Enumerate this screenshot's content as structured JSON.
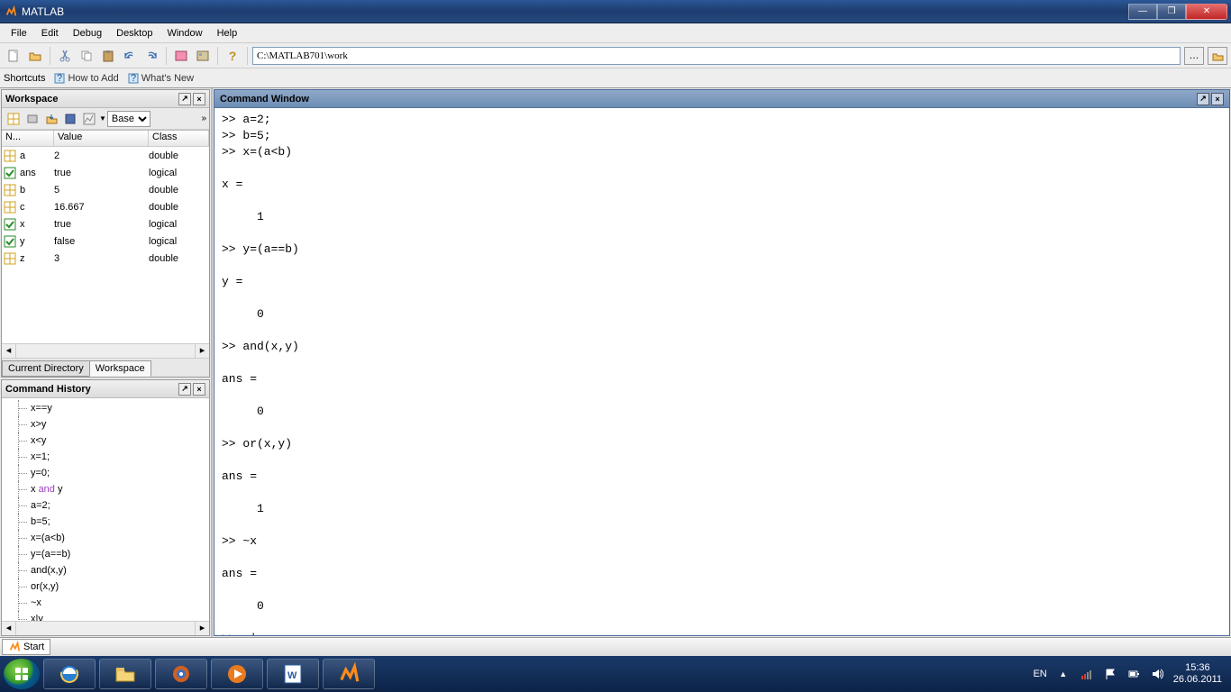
{
  "window": {
    "title": "MATLAB"
  },
  "menu": [
    "File",
    "Edit",
    "Debug",
    "Desktop",
    "Window",
    "Help"
  ],
  "toolbar": {
    "path": "C:\\MATLAB701\\work"
  },
  "shortcuts": {
    "label": "Shortcuts",
    "howto": "How to Add",
    "whatsnew": "What's New"
  },
  "workspace": {
    "title": "Workspace",
    "scope": "Base",
    "headers": {
      "name": "N...",
      "value": "Value",
      "class": "Class"
    },
    "rows": [
      {
        "icon": "grid",
        "name": "a",
        "value": "2",
        "class": "double"
      },
      {
        "icon": "bool",
        "name": "ans",
        "value": "true",
        "class": "logical"
      },
      {
        "icon": "grid",
        "name": "b",
        "value": "5",
        "class": "double"
      },
      {
        "icon": "grid",
        "name": "c",
        "value": "16.667",
        "class": "double"
      },
      {
        "icon": "bool",
        "name": "x",
        "value": "true",
        "class": "logical"
      },
      {
        "icon": "bool",
        "name": "y",
        "value": "false",
        "class": "logical"
      },
      {
        "icon": "grid",
        "name": "z",
        "value": "3",
        "class": "double"
      }
    ],
    "tabs": {
      "currentdir": "Current Directory",
      "workspace": "Workspace"
    }
  },
  "history": {
    "title": "Command History",
    "lines": [
      {
        "text": "x==y"
      },
      {
        "text": "x>y"
      },
      {
        "text": "x<y"
      },
      {
        "text": "x=1;"
      },
      {
        "text": "y=0;"
      },
      {
        "text": "x and y",
        "styled": true
      },
      {
        "text": "a=2;"
      },
      {
        "text": "b=5;"
      },
      {
        "text": "x=(a<b)"
      },
      {
        "text": "y=(a==b)"
      },
      {
        "text": "and(x,y)"
      },
      {
        "text": "or(x,y)"
      },
      {
        "text": "~x"
      },
      {
        "text": "x|y"
      }
    ]
  },
  "cmd": {
    "title": "Command Window",
    "content": ">> a=2;\n>> b=5;\n>> x=(a<b)\n\nx =\n\n     1\n\n>> y=(a==b)\n\ny =\n\n     0\n\n>> and(x,y)\n\nans =\n\n     0\n\n>> or(x,y)\n\nans =\n\n     1\n\n>> ~x\n\nans =\n\n     0\n\n>> x|y"
  },
  "status": {
    "start": "Start"
  },
  "system": {
    "lang": "EN",
    "time": "15:36",
    "date": "26.06.2011"
  }
}
